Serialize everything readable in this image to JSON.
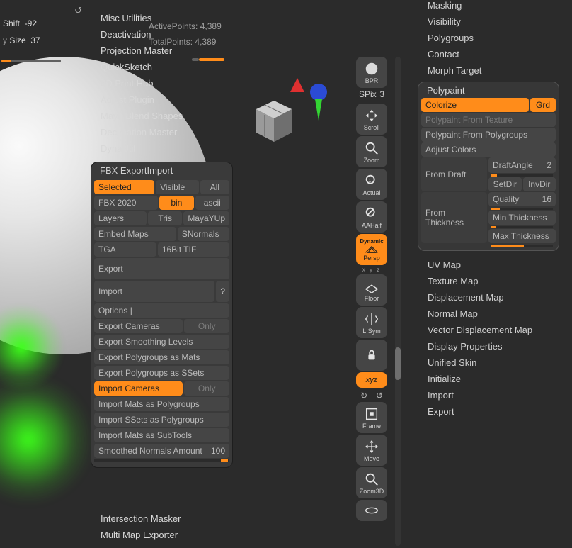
{
  "top_sliders": {
    "shift_label": "Shift",
    "shift_value": "-92",
    "size_label": "Size",
    "size_value": "37"
  },
  "counts": {
    "active_label": "ActivePoints:",
    "active_value": "4,389",
    "total_label": "TotalPoints:",
    "total_value": "4,389"
  },
  "zplugins": [
    "Misc Utilities",
    "Deactivation",
    "Projection Master",
    "QuickSketch",
    "3D Print Hub",
    "Adjust Plugin",
    "Maya Blend Shapes",
    "Decimation Master",
    "DynaUtil"
  ],
  "fbx": {
    "title": "FBX ExportImport",
    "row1": {
      "selected": "Selected",
      "visible": "Visible",
      "all": "All"
    },
    "row2": {
      "ver": "FBX 2020",
      "bin": "bin",
      "ascii": "ascii"
    },
    "row3": {
      "layers": "Layers",
      "tris": "Tris",
      "mayayup": "MayaYUp"
    },
    "row4": {
      "embed": "Embed Maps",
      "snorm": "SNormals"
    },
    "row5": {
      "tga": "TGA",
      "tif": "16Bit TIF"
    },
    "export": "Export",
    "import": "Import",
    "q": "?",
    "options": "Options  |",
    "ecams": "Export Cameras",
    "only1": "Only",
    "esmooth": "Export Smoothing Levels",
    "epmats": "Export Polygroups as Mats",
    "epssets": "Export Polygroups as SSets",
    "icams": "Import Cameras",
    "only2": "Only",
    "imats": "Import Mats as Polygroups",
    "issets": "Import SSets as Polygroups",
    "imsub": "Import Mats as SubTools",
    "smoothed": "Smoothed Normals Amount",
    "smoothed_val": "100",
    "after": [
      "Intersection Masker",
      "Multi Map Exporter"
    ]
  },
  "icons": {
    "bpr": "BPR",
    "spix": "SPix",
    "spix_val": "3",
    "scroll": "Scroll",
    "zoom": "Zoom",
    "actual": "Actual",
    "aahalf": "AAHalf",
    "persp": "Persp",
    "dynamic": "Dynamic",
    "floor": "Floor",
    "lsym": "L.Sym",
    "xyz": "xyz",
    "frame": "Frame",
    "move": "Move",
    "zoom3d": "Zoom3D"
  },
  "right_sections_top": [
    "Masking",
    "Visibility",
    "Polygroups",
    "Contact",
    "Morph Target"
  ],
  "polypaint": {
    "title": "Polypaint",
    "colorize": "Colorize",
    "grd": "Grd",
    "from_tex": "Polypaint From Texture",
    "from_pg": "Polypaint From Polygroups",
    "adjust": "Adjust Colors",
    "from_draft": "From Draft",
    "draft_angle": "DraftAngle",
    "draft_angle_val": "2",
    "setdir": "SetDir",
    "invdir": "InvDir",
    "from_thick": "From Thickness",
    "quality": "Quality",
    "quality_val": "16",
    "min": "Min Thickness",
    "max": "Max Thickness"
  },
  "right_sections_bottom": [
    "UV Map",
    "Texture Map",
    "Displacement Map",
    "Normal Map",
    "Vector Displacement Map",
    "Display Properties",
    "Unified Skin",
    "Initialize",
    "Import",
    "Export"
  ]
}
